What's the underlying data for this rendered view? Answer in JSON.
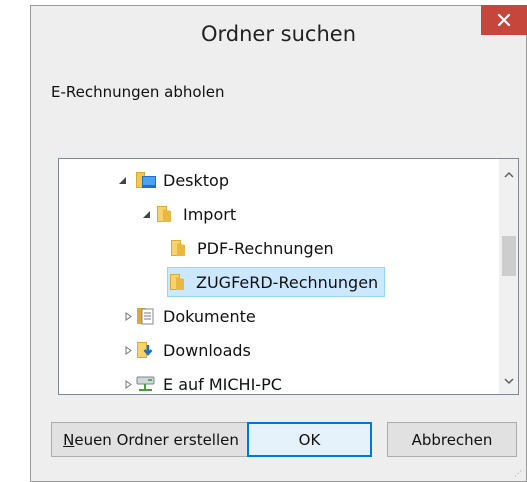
{
  "dialog": {
    "title": "Ordner suchen",
    "description": "E-Rechnungen abholen"
  },
  "tree": {
    "items": [
      {
        "label": "Desktop",
        "icon": "desktop-folder-icon",
        "expanded": true,
        "level": 1
      },
      {
        "label": "Import",
        "icon": "folder-icon",
        "expanded": true,
        "level": 2
      },
      {
        "label": "PDF-Rechnungen",
        "icon": "folder-icon",
        "level": 3
      },
      {
        "label": "ZUGFeRD-Rechnungen",
        "icon": "folder-icon",
        "level": 3,
        "selected": true
      },
      {
        "label": "Dokumente",
        "icon": "documents-icon",
        "expanded": false,
        "level": 1
      },
      {
        "label": "Downloads",
        "icon": "downloads-icon",
        "expanded": false,
        "level": 1
      },
      {
        "label": "E auf MICHI-PC",
        "icon": "network-drive-icon",
        "expanded": false,
        "level": 1
      }
    ]
  },
  "buttons": {
    "new_folder_prefix": "N",
    "new_folder_rest": "euen Ordner erstellen",
    "ok": "OK",
    "cancel": "Abbrechen"
  },
  "colors": {
    "close": "#c7463c",
    "selection": "#cce8ff",
    "default_button_border": "#0078d7"
  }
}
